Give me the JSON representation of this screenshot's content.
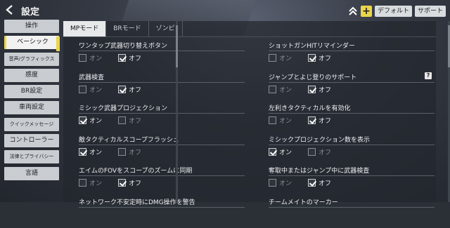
{
  "header": {
    "title": "設定",
    "back_icon": "back-arrow-icon",
    "buttons": {
      "plus": "+",
      "default": "デフォルト",
      "support": "サポート"
    }
  },
  "sidebar": {
    "items": [
      {
        "label": "操作"
      },
      {
        "label": "ベーシック",
        "active": true
      },
      {
        "label": "音声/グラフィックス"
      },
      {
        "label": "感度"
      },
      {
        "label": "BR設定"
      },
      {
        "label": "車両設定"
      },
      {
        "label": "クイックメッセージ"
      },
      {
        "label": "コントローラー"
      },
      {
        "label": "法律とプライバシー"
      },
      {
        "label": "言語"
      }
    ]
  },
  "tabs": [
    {
      "label": "MPモード",
      "active": true
    },
    {
      "label": "BRモード"
    },
    {
      "label": "ゾンビ"
    }
  ],
  "options": {
    "on": "オン",
    "off": "オフ"
  },
  "settings_left": [
    {
      "label": "ワンタップ武器切り替えボタン",
      "value": "off"
    },
    {
      "label": "武器検査",
      "value": "off"
    },
    {
      "label": "ミシック武器プロジェクション",
      "value": "on"
    },
    {
      "label": "敵タクティカルスコープフラッシュ",
      "value": "on"
    },
    {
      "label": "エイムのFOVをスコープのズームに同期",
      "value": "off"
    },
    {
      "label": "ネットワーク不安定時にDMG操作を警告"
    }
  ],
  "settings_right": [
    {
      "label": "ショットガンHITリマインダー",
      "value": "off"
    },
    {
      "label": "ジャンプとよじ登りのサポート",
      "value": "off",
      "help": "?"
    },
    {
      "label": "左利きタクティカルを有効化",
      "value": "off"
    },
    {
      "label": "ミシックプロジェクション数を表示",
      "value": "on"
    },
    {
      "label": "奪取中またはジャンプ中に武器検査",
      "value": "off"
    },
    {
      "label": "チームメイトのマーカー"
    }
  ],
  "colors": {
    "accent": "#e9d64a",
    "panel": "#23272e",
    "tab_active": "#e6e8ea"
  }
}
